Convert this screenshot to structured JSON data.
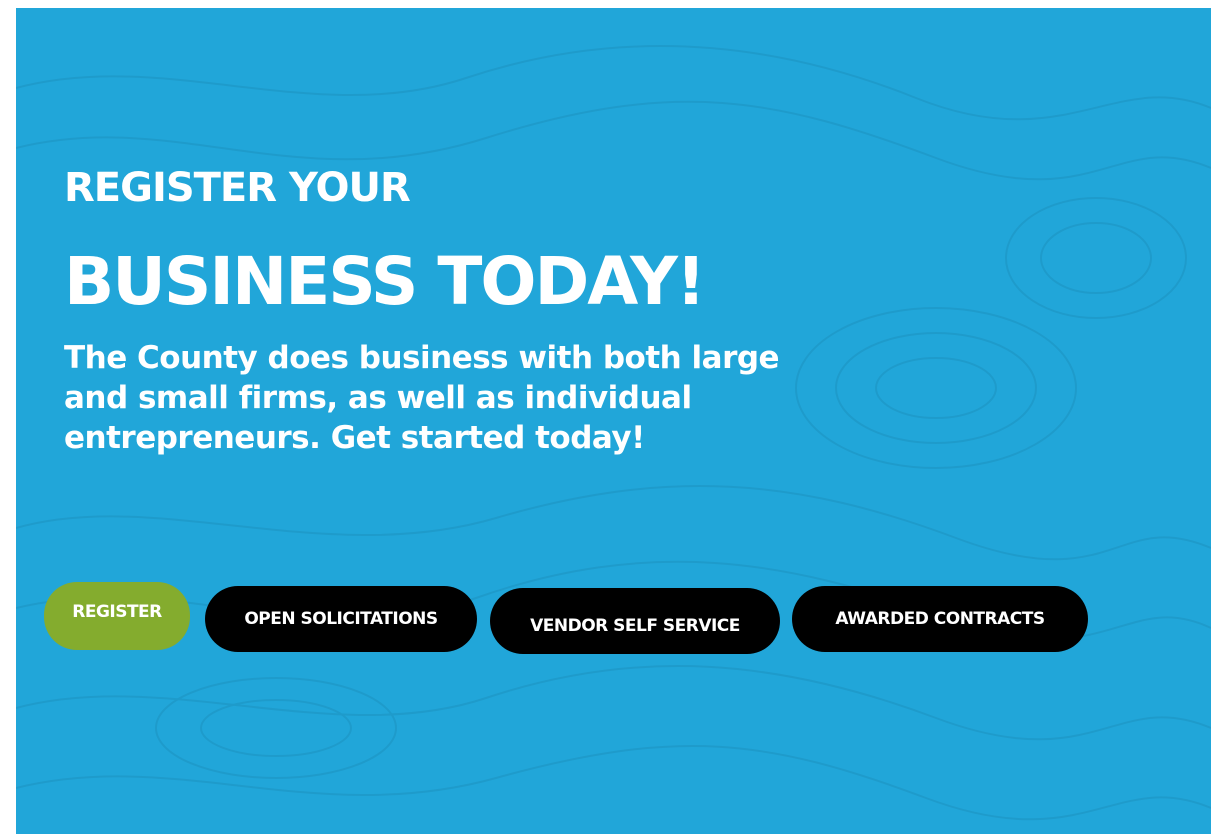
{
  "hero": {
    "background_color": "#21a6d9",
    "heading_line1": "REGISTER YOUR",
    "heading_line2": "BUSINESS TODAY!",
    "intro": "The County does business with both large and small firms, as well as individual entrepreneurs. Get started today!"
  },
  "buttons": {
    "register": "REGISTER",
    "open_solicitations": "OPEN SOLICITATIONS",
    "vendor_self_service": "VENDOR SELF SERVICE",
    "awarded_contracts": "AWARDED CONTRACTS"
  },
  "colors": {
    "register_button": "#84ac2e",
    "dark_button": "#000000",
    "text": "#ffffff"
  }
}
